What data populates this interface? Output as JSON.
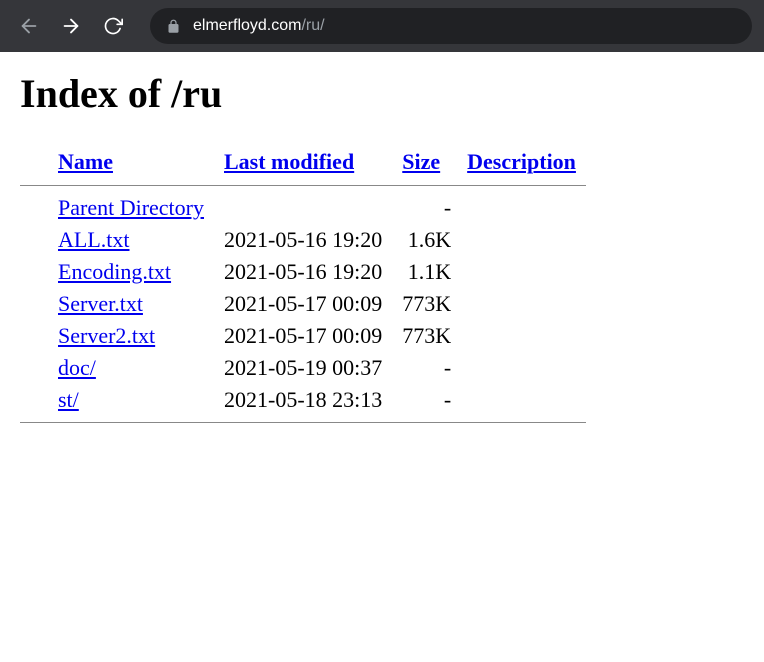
{
  "browser": {
    "url_host": "elmerfloyd.com",
    "url_path": "/ru/"
  },
  "page": {
    "heading": "Index of /ru"
  },
  "headers": {
    "name": "Name",
    "last_modified": "Last modified",
    "size": "Size",
    "description": "Description"
  },
  "rows": [
    {
      "name": "Parent Directory",
      "last_modified": "",
      "size": "-",
      "description": ""
    },
    {
      "name": "ALL.txt",
      "last_modified": "2021-05-16 19:20",
      "size": "1.6K",
      "description": ""
    },
    {
      "name": "Encoding.txt",
      "last_modified": "2021-05-16 19:20",
      "size": "1.1K",
      "description": ""
    },
    {
      "name": "Server.txt",
      "last_modified": "2021-05-17 00:09",
      "size": "773K",
      "description": ""
    },
    {
      "name": "Server2.txt",
      "last_modified": "2021-05-17 00:09",
      "size": "773K",
      "description": ""
    },
    {
      "name": "doc/",
      "last_modified": "2021-05-19 00:37",
      "size": "-",
      "description": ""
    },
    {
      "name": "st/",
      "last_modified": "2021-05-18 23:13",
      "size": "-",
      "description": ""
    }
  ]
}
